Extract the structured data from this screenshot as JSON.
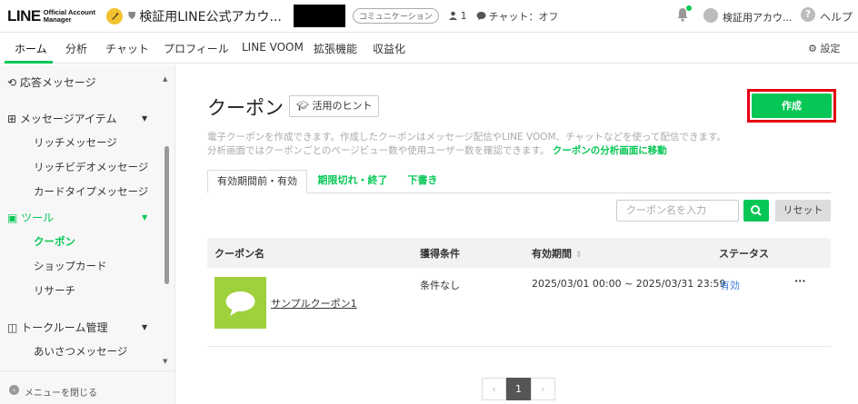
{
  "brand": {
    "logo_text": "LINE",
    "logo_sub_line1": "Official Account",
    "logo_sub_line2": "Manager"
  },
  "account": {
    "name": "検証用LINE公式アカウ...",
    "type_badge": "コミュニケーション",
    "friends_count": "1",
    "chat_status": "チャット：オフ"
  },
  "user": {
    "name": "検証用アカウ...",
    "help_label": "ヘルプ"
  },
  "nav": {
    "items": [
      "ホーム",
      "分析",
      "チャット",
      "プロフィール",
      "LINE VOOM",
      "拡張機能",
      "収益化"
    ],
    "settings_label": "設定"
  },
  "sidebar": {
    "auto_reply": "応答メッセージ",
    "message_items": "メッセージアイテム",
    "message_items_children": [
      "リッチメッセージ",
      "リッチビデオメッセージ",
      "カードタイプメッセージ"
    ],
    "tools": "ツール",
    "tools_children": [
      "クーポン",
      "ショップカード",
      "リサーチ"
    ],
    "chatroom": "トークルーム管理",
    "chatroom_children": [
      "あいさつメッセージ"
    ],
    "close_menu": "メニューを閉じる"
  },
  "main": {
    "title": "クーポン",
    "hint_button": "活用のヒント",
    "create_button": "作成",
    "description_line1": "電子クーポンを作成できます。作成したクーポンはメッセージ配信やLINE VOOM、チャットなどを使って配信できます。",
    "description_line2": "分析画面ではクーポンごとのページビュー数や使用ユーザー数を確認できます。",
    "description_link": "クーポンの分析画面に移動",
    "tabs": [
      "有効期間前・有効",
      "期限切れ・終了",
      "下書き"
    ],
    "search_placeholder": "クーポン名を入力",
    "reset_button": "リセット",
    "table": {
      "headers": [
        "クーポン名",
        "獲得条件",
        "有効期間",
        "ステータス"
      ],
      "rows": [
        {
          "name": "サンプルクーポン1",
          "condition": "条件なし",
          "period": "2025/03/01 00:00 ~ 2025/03/31 23:59",
          "status": "有効",
          "more": "···"
        }
      ]
    },
    "pagination": {
      "prev": "‹",
      "current": "1",
      "next": "›"
    }
  },
  "colors": {
    "accent": "#06c755",
    "highlight_frame": "#e60012",
    "status_link": "#3e7bd6"
  }
}
